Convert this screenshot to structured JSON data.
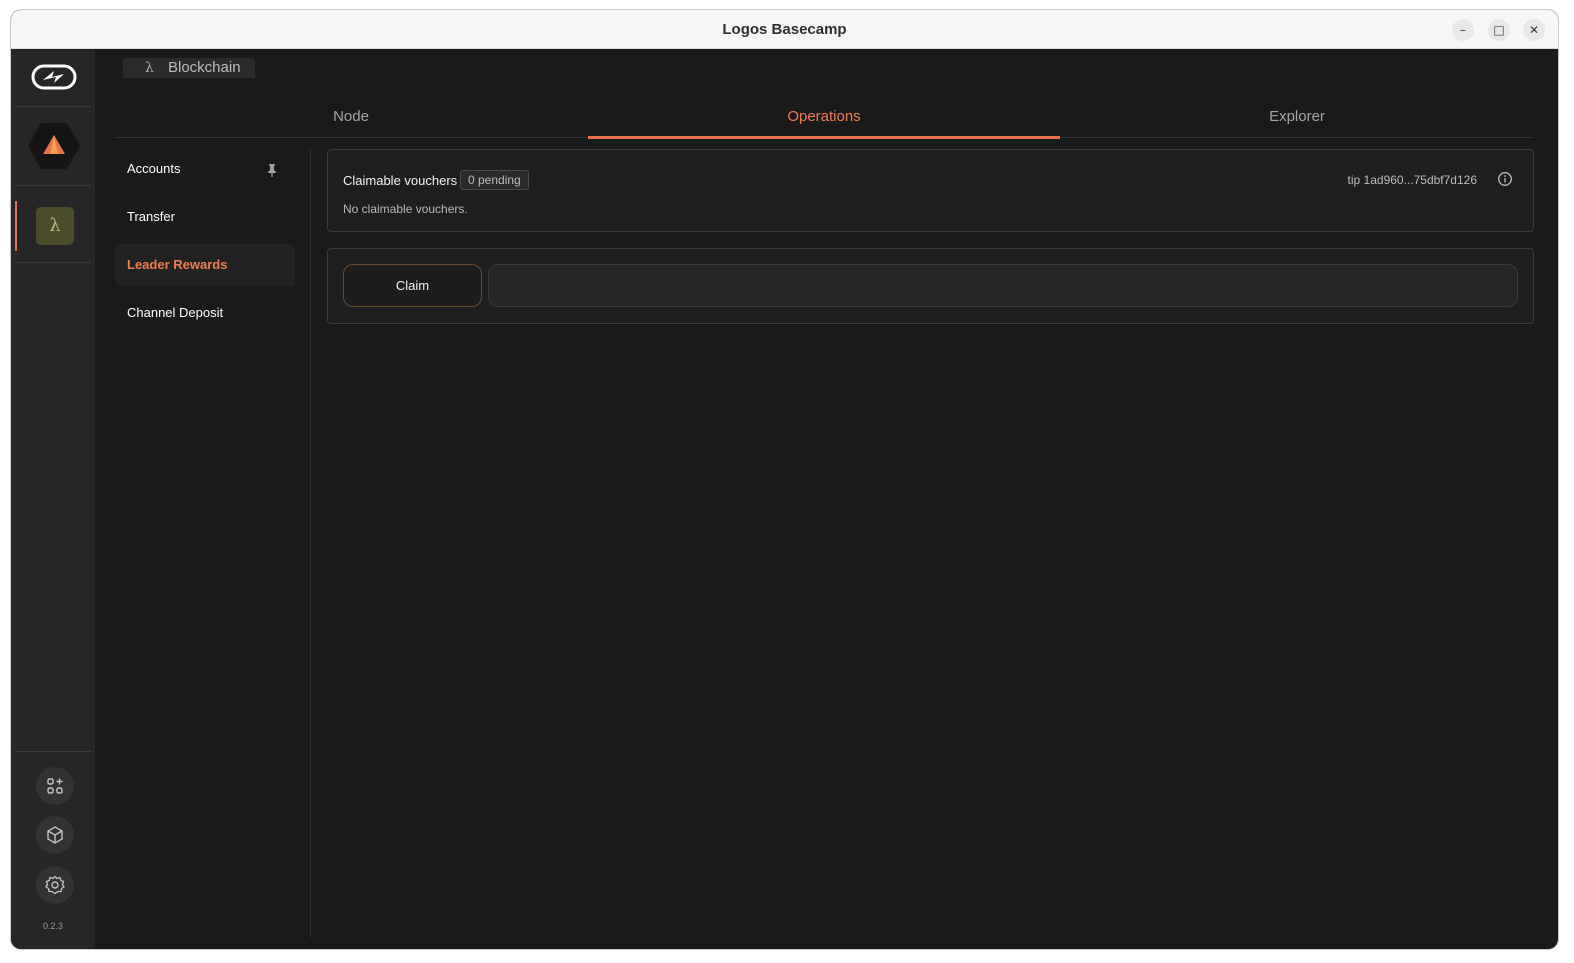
{
  "window": {
    "title": "Logos Basecamp",
    "controls": {
      "minimize": "–",
      "maximize": "□",
      "close": "✕"
    }
  },
  "rail": {
    "logo_icon": "logos-logo-icon",
    "app_icon": "basecamp-tent-icon",
    "active_app_icon": "λ",
    "bottom_icons": [
      "apps-add-icon",
      "package-icon",
      "settings-gear-icon"
    ],
    "version": "0.2.3"
  },
  "breadcrumb": {
    "icon": "λ",
    "label": "Blockchain"
  },
  "tabs": [
    {
      "label": "Node"
    },
    {
      "label": "Operations"
    },
    {
      "label": "Explorer"
    }
  ],
  "subnav": {
    "items": [
      {
        "label": "Accounts"
      },
      {
        "label": "Transfer"
      },
      {
        "label": "Leader Rewards"
      },
      {
        "label": "Channel Deposit"
      }
    ]
  },
  "vouchers": {
    "title": "Claimable vouchers",
    "badge": "0 pending",
    "empty_message": "No claimable vouchers.",
    "tip": "tip 1ad960...75dbf7d126"
  },
  "claim": {
    "button_label": "Claim",
    "input_value": "",
    "input_placeholder": ""
  },
  "colors": {
    "accent": "#e8704a",
    "background": "#1a1a1a",
    "rail": "#262626"
  }
}
